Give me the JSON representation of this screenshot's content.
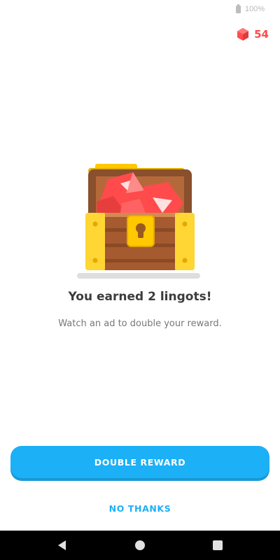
{
  "status_bar": {
    "battery_text": "100%",
    "icon": "battery-icon"
  },
  "header": {
    "lingot_count": "54",
    "icon": "gem-icon",
    "accent_color": "#ff4b4b"
  },
  "reward": {
    "image": "treasure-chest-illustration",
    "title": "You earned 2 lingots!",
    "subtitle": "Watch an ad to double your reward."
  },
  "actions": {
    "primary_label": "DOUBLE REWARD",
    "secondary_label": "NO THANKS",
    "primary_color": "#1cb0f6"
  },
  "nav_bar": {
    "back_icon": "back-triangle-icon",
    "home_icon": "home-circle-icon",
    "recent_icon": "recent-apps-square-icon"
  }
}
